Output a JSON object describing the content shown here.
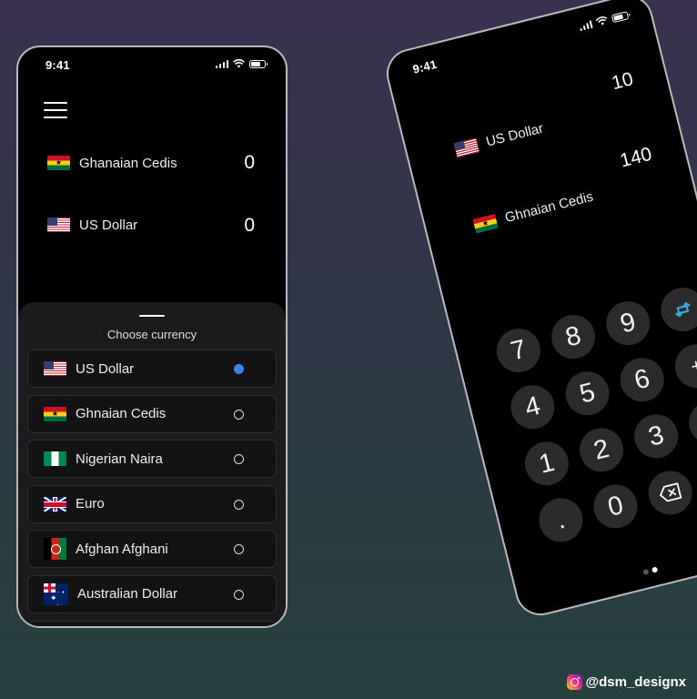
{
  "colors": {
    "accent": "#3b82f6",
    "swap_icon": "#3aa6e0",
    "key_bg": "#2b2b2e",
    "sheet_bg": "#1b1b1d",
    "item_bg": "#131315"
  },
  "left_phone": {
    "status": {
      "time": "9:41"
    },
    "conversion": [
      {
        "currency": "Ghanaian Cedis",
        "flag": "ghana-flag",
        "value": "0"
      },
      {
        "currency": "US Dollar",
        "flag": "us-flag",
        "value": "0"
      }
    ],
    "sheet": {
      "title": "Choose currency",
      "items": [
        {
          "label": "US Dollar",
          "flag": "us-flag",
          "selected": true
        },
        {
          "label": "Ghnaian Cedis",
          "flag": "ghana-flag",
          "selected": false
        },
        {
          "label": "Nigerian Naira",
          "flag": "nigeria-flag",
          "selected": false
        },
        {
          "label": "Euro",
          "flag": "uk-flag",
          "selected": false
        },
        {
          "label": "Afghan Afghani",
          "flag": "afghanistan-flag",
          "selected": false
        },
        {
          "label": "Australian Dollar",
          "flag": "australia-flag",
          "selected": false
        }
      ]
    }
  },
  "right_phone": {
    "status": {
      "time": "9:41"
    },
    "top": {
      "currency": "US Dollar",
      "flag": "us-flag",
      "amount": "10"
    },
    "bottom": {
      "currency": "Ghnaian Cedis",
      "flag": "ghana-flag",
      "amount": "140"
    },
    "keys": {
      "k7": "7",
      "k8": "8",
      "k9": "9",
      "k4": "4",
      "k5": "5",
      "k6": "6",
      "k1": "1",
      "k2": "2",
      "k3": "3",
      "dot": ".",
      "k0": "0",
      "plus": "+",
      "minus": "-",
      "equals": "="
    },
    "pagination": {
      "count": 2,
      "active": 2
    }
  },
  "watermark": {
    "handle": "@dsm_designx",
    "icon": "instagram-icon"
  }
}
